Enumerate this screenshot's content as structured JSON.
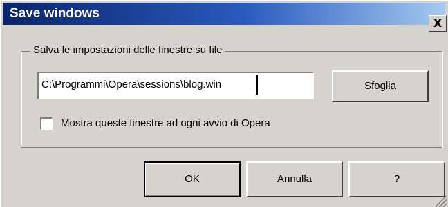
{
  "window": {
    "title": "Save windows",
    "close_glyph": "X"
  },
  "group": {
    "legend": "Salva le impostazioni delle finestre su file"
  },
  "path_field": {
    "value": "C:\\Programmi\\Opera\\sessions\\blog.win"
  },
  "buttons": {
    "browse": "Sfoglia",
    "ok": "OK",
    "cancel": "Annulla",
    "help": "?"
  },
  "startup_checkbox": {
    "label": "Mostra queste finestre ad ogni avvio di Opera",
    "checked": false
  },
  "colors": {
    "titlebar_start": "#0a246a",
    "titlebar_end": "#a6caf0",
    "face": "#d6d3ce"
  },
  "icons": {
    "close": "close-icon",
    "resize": "resize-grip-icon"
  }
}
